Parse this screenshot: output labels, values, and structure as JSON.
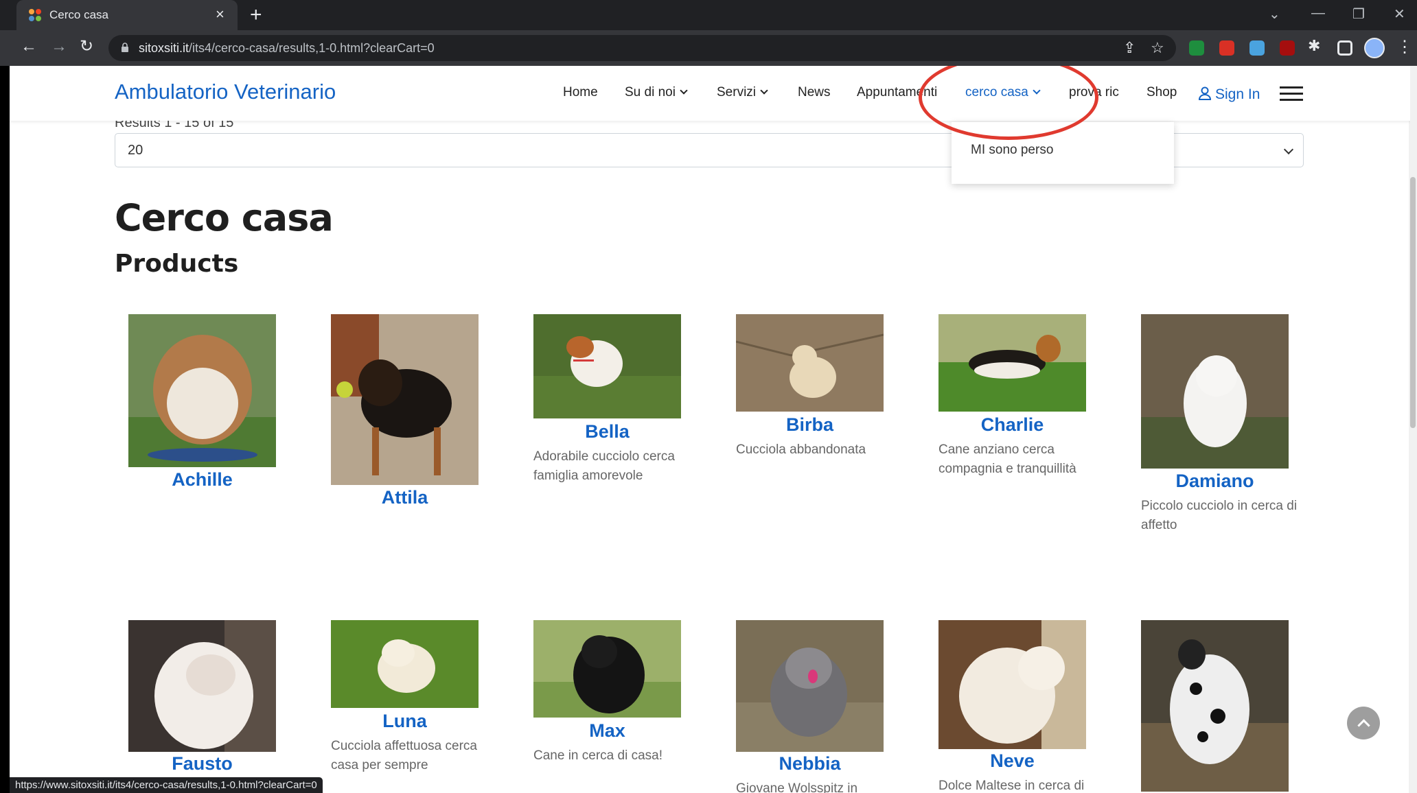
{
  "browser": {
    "tab_title": "Cerco casa",
    "url_host": "sitoxsiti.it",
    "url_path": "/its4/cerco-casa/results,1-0.html?clearCart=0",
    "status_url": "https://www.sitoxsiti.it/its4/cerco-casa/results,1-0.html?clearCart=0",
    "icons": [
      "back-icon",
      "forward-icon",
      "reload-icon",
      "lock-icon",
      "share-icon",
      "star-icon",
      "extensions-icon",
      "sidepanel-icon",
      "menu-icon"
    ]
  },
  "site": {
    "brand": "Ambulatorio Veterinario",
    "nav": [
      {
        "label": "Home"
      },
      {
        "label": "Su di noi"
      },
      {
        "label": "Servizi"
      },
      {
        "label": "News"
      },
      {
        "label": "Appuntamenti"
      },
      {
        "label": "cerco casa"
      },
      {
        "label": "prova ric"
      },
      {
        "label": "Shop"
      }
    ],
    "signin": "Sign In",
    "dropdown": {
      "item": "MI sono perso"
    },
    "accent_color": "#1463c4",
    "annotation_color": "#e03a2f"
  },
  "main": {
    "results_text": "Results 1 - 15 of 15",
    "limit_value": "20",
    "page_title": "Cerco casa",
    "section_title": "Products",
    "products": [
      {
        "name": "Achille",
        "desc": ""
      },
      {
        "name": "Attila",
        "desc": ""
      },
      {
        "name": "Bella",
        "desc": "Adorabile cucciolo cerca famiglia amorevole"
      },
      {
        "name": "Birba",
        "desc": "Cucciola abbandonata"
      },
      {
        "name": "Charlie",
        "desc": "Cane anziano cerca compagnia e tranquillità"
      },
      {
        "name": "Damiano",
        "desc": "Piccolo cucciolo in cerca di affetto"
      },
      {
        "name": "Fausto",
        "desc": ""
      },
      {
        "name": "Luna",
        "desc": "Cucciola affettuosa cerca casa per sempre"
      },
      {
        "name": "Max",
        "desc": "Cane in cerca di casa!"
      },
      {
        "name": "Nebbia",
        "desc": "Giovane Wolsspitz in"
      },
      {
        "name": "Neve",
        "desc": "Dolce Maltese in cerca di"
      },
      {
        "name": "",
        "desc": ""
      }
    ]
  }
}
